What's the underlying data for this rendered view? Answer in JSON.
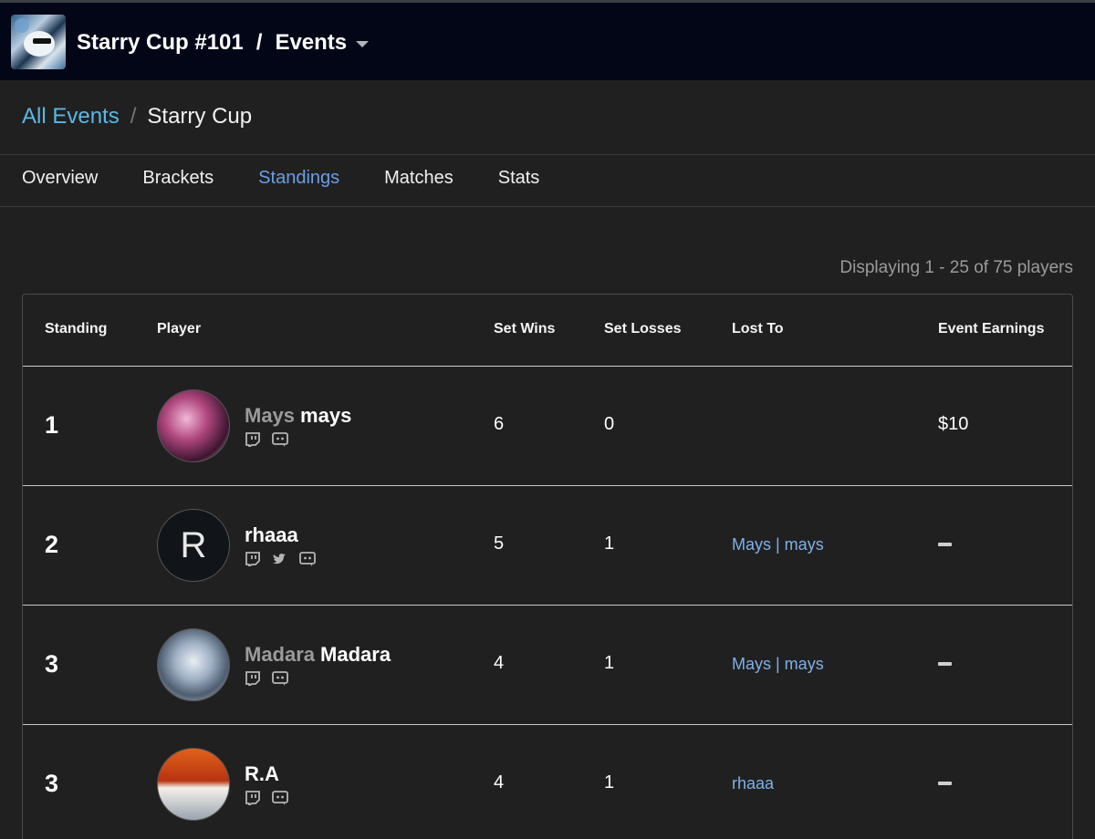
{
  "header": {
    "tournament": "Starry Cup #101",
    "separator": "/",
    "section": "Events"
  },
  "breadcrumb": {
    "link": "All Events",
    "separator": "/",
    "current": "Starry Cup"
  },
  "tabs": [
    {
      "label": "Overview",
      "active": false
    },
    {
      "label": "Brackets",
      "active": false
    },
    {
      "label": "Standings",
      "active": true
    },
    {
      "label": "Matches",
      "active": false
    },
    {
      "label": "Stats",
      "active": false
    }
  ],
  "display_count": "Displaying 1 - 25 of 75 players",
  "table": {
    "headers": {
      "standing": "Standing",
      "player": "Player",
      "set_wins": "Set Wins",
      "set_losses": "Set Losses",
      "lost_to": "Lost To",
      "event_earnings": "Event Earnings"
    },
    "rows": [
      {
        "standing": "1",
        "prefix": "Mays",
        "name": "mays",
        "avatar_letter": "",
        "socials": [
          "twitch-icon",
          "discord-icon"
        ],
        "set_wins": "6",
        "set_losses": "0",
        "lost_to": "",
        "earnings": "$10"
      },
      {
        "standing": "2",
        "prefix": "",
        "name": "rhaaa",
        "avatar_letter": "R",
        "socials": [
          "twitch-icon",
          "twitter-icon",
          "discord-icon"
        ],
        "set_wins": "5",
        "set_losses": "1",
        "lost_to": "Mays | mays",
        "earnings": ""
      },
      {
        "standing": "3",
        "prefix": "Madara",
        "name": "Madara",
        "avatar_letter": "",
        "socials": [
          "twitch-icon",
          "discord-icon"
        ],
        "set_wins": "4",
        "set_losses": "1",
        "lost_to": "Mays | mays",
        "earnings": ""
      },
      {
        "standing": "3",
        "prefix": "",
        "name": "R.A",
        "avatar_letter": "",
        "socials": [
          "twitch-icon",
          "discord-icon"
        ],
        "set_wins": "4",
        "set_losses": "1",
        "lost_to": "rhaaa",
        "earnings": ""
      }
    ]
  },
  "colors": {
    "topbar_bg": "#020617",
    "page_bg": "#202020",
    "link": "#5ab8e6",
    "active_tab": "#6a9ee6",
    "lost_to_link": "#7fb0e6"
  }
}
